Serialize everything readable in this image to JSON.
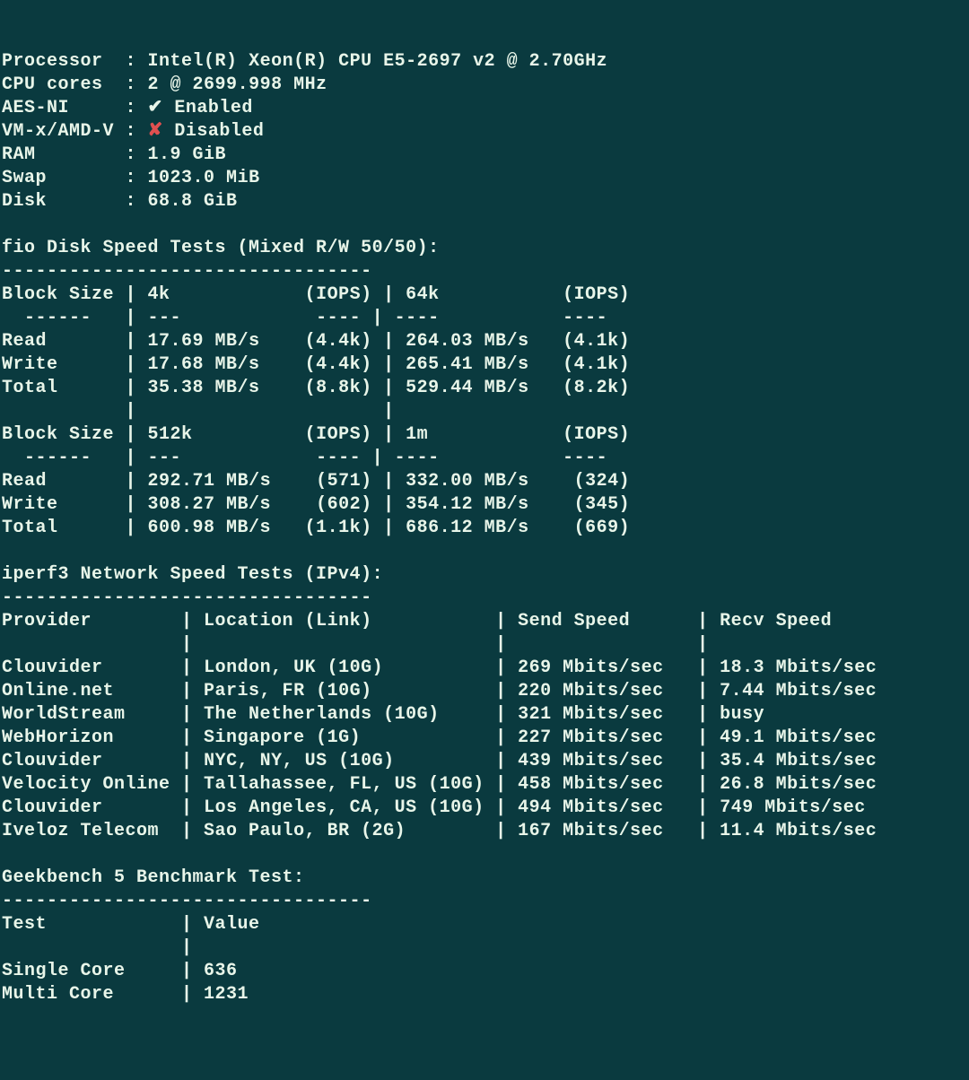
{
  "sysinfo": {
    "processor_label": "Processor",
    "processor_value": "Intel(R) Xeon(R) CPU E5-2697 v2 @ 2.70GHz",
    "cores_label": "CPU cores",
    "cores_value": "2 @ 2699.998 MHz",
    "aesni_label": "AES-NI",
    "aesni_mark": "✔",
    "aesni_value": "Enabled",
    "vmx_label": "VM-x/AMD-V",
    "vmx_mark": "✘",
    "vmx_value": "Disabled",
    "ram_label": "RAM",
    "ram_value": "1.9 GiB",
    "swap_label": "Swap",
    "swap_value": "1023.0 MiB",
    "disk_label": "Disk",
    "disk_value": "68.8 GiB"
  },
  "fio": {
    "title": "fio Disk Speed Tests (Mixed R/W 50/50):",
    "dashes": "---------------------------------",
    "hdr_block": "Block Size",
    "hdr_4k": "4k",
    "hdr_iops1": "(IOPS)",
    "hdr_64k": "64k",
    "hdr_iops2": "(IOPS)",
    "hdr_dash1": "  ------   |",
    "hdr_dash2": "---",
    "hdr_dash3": "----",
    "hdr_dash4": "----",
    "hdr_dash5": "----",
    "t1": {
      "read_lbl": "Read",
      "read_v1": "17.69 MB/s",
      "read_i1": "(4.4k)",
      "read_v2": "264.03 MB/s",
      "read_i2": "(4.1k)",
      "write_lbl": "Write",
      "write_v1": "17.68 MB/s",
      "write_i1": "(4.4k)",
      "write_v2": "265.41 MB/s",
      "write_i2": "(4.1k)",
      "total_lbl": "Total",
      "total_v1": "35.38 MB/s",
      "total_i1": "(8.8k)",
      "total_v2": "529.44 MB/s",
      "total_i2": "(8.2k)"
    },
    "hdr_512k": "512k",
    "hdr_1m": "1m",
    "t2": {
      "read_lbl": "Read",
      "read_v1": "292.71 MB/s",
      "read_i1": "(571)",
      "read_v2": "332.00 MB/s",
      "read_i2": "(324)",
      "write_lbl": "Write",
      "write_v1": "308.27 MB/s",
      "write_i1": "(602)",
      "write_v2": "354.12 MB/s",
      "write_i2": "(345)",
      "total_lbl": "Total",
      "total_v1": "600.98 MB/s",
      "total_i1": "(1.1k)",
      "total_v2": "686.12 MB/s",
      "total_i2": "(669)"
    }
  },
  "iperf": {
    "title": "iperf3 Network Speed Tests (IPv4):",
    "dashes": "---------------------------------",
    "hdr_provider": "Provider",
    "hdr_location": "Location (Link)",
    "hdr_send": "Send Speed",
    "hdr_recv": "Recv Speed",
    "rows": [
      {
        "p": "Clouvider",
        "l": "London, UK (10G)",
        "s": "269 Mbits/sec",
        "r": "18.3 Mbits/sec"
      },
      {
        "p": "Online.net",
        "l": "Paris, FR (10G)",
        "s": "220 Mbits/sec",
        "r": "7.44 Mbits/sec"
      },
      {
        "p": "WorldStream",
        "l": "The Netherlands (10G)",
        "s": "321 Mbits/sec",
        "r": "busy"
      },
      {
        "p": "WebHorizon",
        "l": "Singapore (1G)",
        "s": "227 Mbits/sec",
        "r": "49.1 Mbits/sec"
      },
      {
        "p": "Clouvider",
        "l": "NYC, NY, US (10G)",
        "s": "439 Mbits/sec",
        "r": "35.4 Mbits/sec"
      },
      {
        "p": "Velocity Online",
        "l": "Tallahassee, FL, US (10G)",
        "s": "458 Mbits/sec",
        "r": "26.8 Mbits/sec"
      },
      {
        "p": "Clouvider",
        "l": "Los Angeles, CA, US (10G)",
        "s": "494 Mbits/sec",
        "r": "749 Mbits/sec"
      },
      {
        "p": "Iveloz Telecom",
        "l": "Sao Paulo, BR (2G)",
        "s": "167 Mbits/sec",
        "r": "11.4 Mbits/sec"
      }
    ]
  },
  "geekbench": {
    "title": "Geekbench 5 Benchmark Test:",
    "dashes": "---------------------------------",
    "hdr_test": "Test",
    "hdr_value": "Value",
    "single_lbl": "Single Core",
    "single_val": "636",
    "multi_lbl": "Multi Core",
    "multi_val": "1231"
  }
}
